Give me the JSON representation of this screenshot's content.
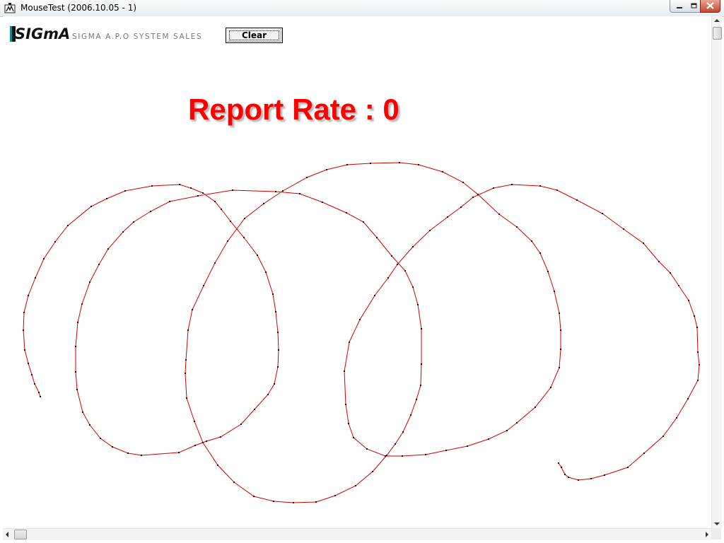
{
  "window": {
    "title": "MouseTest (2006.10.05 - 1)"
  },
  "header": {
    "logo_text": "SIGmA",
    "brand_text": "SIGMA A.P.O SYSTEM SALES",
    "clear_label": "Clear"
  },
  "report": {
    "label": "Report Rate : ",
    "value": "0"
  },
  "colors": {
    "trace": "#cc0000",
    "rate_text": "#ff0000",
    "logo_teal": "#0a8a8a"
  },
  "icons": {
    "app": "mouse-test-icon",
    "minimize": "minimize-icon",
    "maximize": "maximize-icon",
    "close": "close-icon"
  }
}
